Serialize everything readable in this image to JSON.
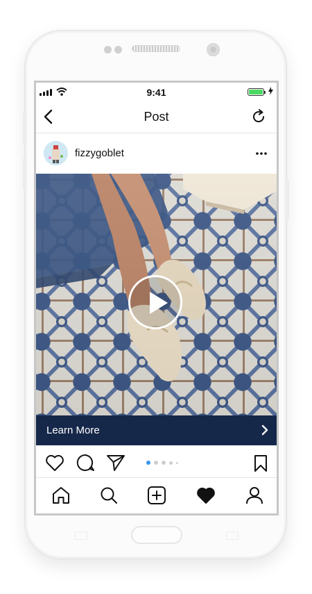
{
  "status_bar": {
    "time": "9:41"
  },
  "navbar": {
    "title": "Post"
  },
  "post": {
    "username": "fizzygoblet"
  },
  "cta": {
    "label": "Learn More"
  },
  "carousel": {
    "active_index": 0,
    "dot_count": 5
  },
  "colors": {
    "accent": "#3897f0",
    "cta_background": "#16284a",
    "battery": "#4cd964"
  },
  "icons": {
    "back": "chevron-left-icon",
    "refresh": "refresh-icon",
    "more": "more-icon",
    "play": "play-icon",
    "like": "heart-outline-icon",
    "comment": "comment-icon",
    "share": "send-icon",
    "save": "bookmark-icon",
    "home": "home-icon",
    "search": "search-icon",
    "add": "add-icon",
    "activity": "heart-filled-icon",
    "profile": "profile-icon"
  }
}
